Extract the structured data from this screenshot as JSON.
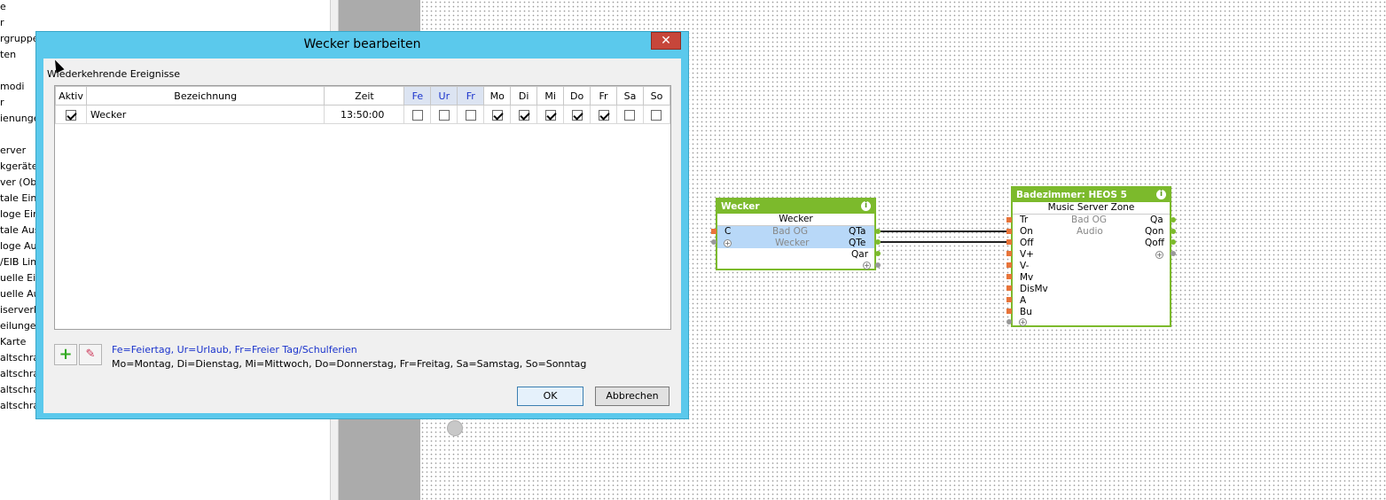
{
  "tree": {
    "items": [
      "e",
      "r",
      "rgruppe",
      "ten",
      "",
      "modi",
      "r",
      "ienunge",
      "",
      "erver",
      "kgeräte",
      "ver (Obj",
      "tale Eing",
      "loge Ein",
      "tale Aus",
      "loge Aus",
      "/EIB Lin",
      "uelle Ein",
      "uelle Au",
      "iserverk",
      "eilunge",
      "Karte",
      "altschra",
      "altschra",
      "altschra",
      "altschra"
    ]
  },
  "dialog": {
    "title": "Wecker bearbeiten",
    "close_label": "✕",
    "group_label": "Wiederkehrende Ereignisse",
    "columns": {
      "aktiv": "Aktiv",
      "bezeichnung": "Bezeichnung",
      "zeit": "Zeit",
      "fe": "Fe",
      "ur": "Ur",
      "fr_blue": "Fr",
      "mo": "Mo",
      "di": "Di",
      "mi": "Mi",
      "do": "Do",
      "fr": "Fr",
      "sa": "Sa",
      "so": "So"
    },
    "row": {
      "aktiv": true,
      "bezeichnung": "Wecker",
      "zeit": "13:50:00",
      "fe": false,
      "ur": false,
      "fr_blue": false,
      "mo": true,
      "di": true,
      "mi": true,
      "do": true,
      "fr": true,
      "sa": false,
      "so": false
    },
    "legend_special": "Fe=Feiertag, Ur=Urlaub, Fr=Freier Tag/Schulferien",
    "legend_days": "Mo=Montag, Di=Dienstag, Mi=Mittwoch, Do=Donnerstag, Fr=Freitag, Sa=Samstag, So=Sonntag",
    "add_icon": "plus-icon",
    "delete_icon": "eraser-icon",
    "ok_label": "OK",
    "cancel_label": "Abbrechen"
  },
  "blocks": {
    "wecker": {
      "title": "Wecker",
      "subtitle": "Wecker",
      "in_c": "C",
      "room": "Bad OG",
      "name": "Wecker",
      "out_qta": "QTa",
      "out_qte": "QTe",
      "out_qar": "Qar"
    },
    "heos": {
      "title": "Badezimmer: HEOS 5",
      "subtitle": "Music Server Zone",
      "room": "Bad OG",
      "category": "Audio",
      "inputs": [
        "Tr",
        "On",
        "Off",
        "V+",
        "V-",
        "Mv",
        "DisMv",
        "A",
        "Bu"
      ],
      "outputs": [
        "Qa",
        "Qon",
        "Qoff"
      ]
    }
  },
  "colors": {
    "dialog_frame": "#5bc9ec",
    "block_header": "#7cba2c",
    "close_button": "#c7463a",
    "special_day_header": "#1a33cc",
    "selected_block": "#b8d8f8"
  }
}
